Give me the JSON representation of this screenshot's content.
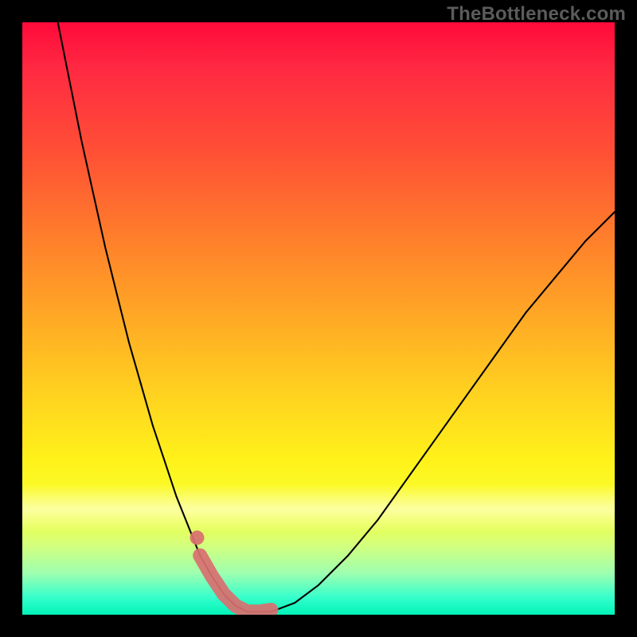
{
  "watermark": "TheBottleneck.com",
  "colors": {
    "frame": "#000000",
    "curve": "#000000",
    "marker": "#d87070",
    "gradient_top": "#ff0a3a",
    "gradient_mid": "#fff21a",
    "gradient_bottom": "#00f3b8"
  },
  "chart_data": {
    "type": "line",
    "title": "",
    "xlabel": "",
    "ylabel": "",
    "xlim": [
      0,
      100
    ],
    "ylim": [
      0,
      100
    ],
    "series": [
      {
        "name": "bottleneck-curve",
        "x": [
          6,
          8,
          10,
          12,
          14,
          16,
          18,
          20,
          22,
          24,
          26,
          28,
          30,
          32,
          34,
          36,
          38,
          42,
          46,
          50,
          55,
          60,
          65,
          70,
          75,
          80,
          85,
          90,
          95,
          100
        ],
        "y": [
          100,
          90,
          80,
          71,
          62,
          54,
          46,
          39,
          32,
          26,
          20,
          15,
          10,
          6.5,
          3.5,
          1.5,
          0.5,
          0.5,
          2,
          5,
          10,
          16,
          23,
          30,
          37,
          44,
          51,
          57,
          63,
          68
        ]
      }
    ],
    "highlight": {
      "name": "optimal-range",
      "x": [
        30,
        32,
        34,
        36,
        38,
        40,
        42
      ],
      "y": [
        10,
        6.5,
        3.5,
        1.5,
        0.5,
        0.5,
        0.8
      ]
    },
    "highlight_point": {
      "x": 29.5,
      "y": 13
    }
  }
}
